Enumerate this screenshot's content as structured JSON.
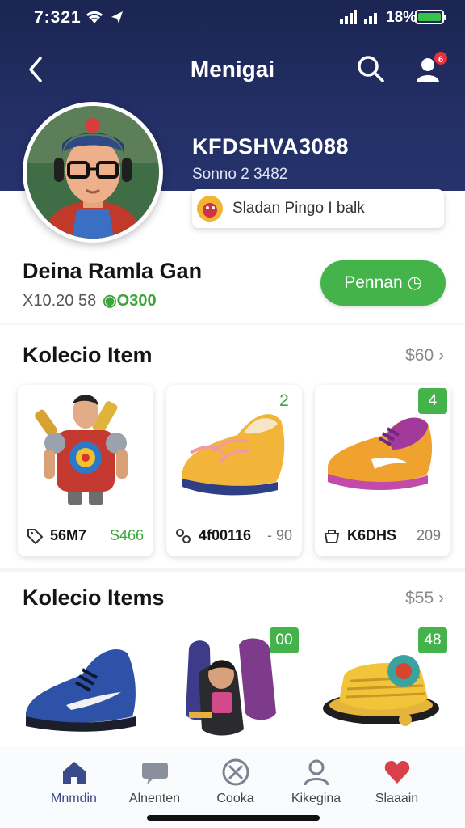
{
  "status_bar": {
    "time": "7:321",
    "battery": "18%"
  },
  "navbar": {
    "title": "Menigai",
    "notification_count": "6"
  },
  "profile": {
    "header_name": "KFDSHVA3088",
    "header_sub": "Sonno 2 3482",
    "page_chip": "Sladan Pingo I balk",
    "name": "Deina Ramla Gan",
    "meta_prefix": "X10.20 58",
    "meta_value": "O300",
    "action_button": "Pennan ◷"
  },
  "section1": {
    "title": "Kolecio Item",
    "more": "$60",
    "items": [
      {
        "name": "56M7",
        "price": "S466",
        "tag": ""
      },
      {
        "name": "4f00116",
        "price": "- 90",
        "tag": "2"
      },
      {
        "name": "K6DHS",
        "price": "209",
        "tag": "4"
      }
    ]
  },
  "section2": {
    "title": "Kolecio Items",
    "more": "$55",
    "items": [
      {
        "tag": ""
      },
      {
        "tag": "00"
      },
      {
        "tag": "48"
      }
    ]
  },
  "tabs": [
    {
      "label": "Mnmdin",
      "icon": "home-icon",
      "active": true
    },
    {
      "label": "Alnenten",
      "icon": "chat-icon",
      "active": false
    },
    {
      "label": "Cooka",
      "icon": "cancel-circle-icon",
      "active": false
    },
    {
      "label": "Kikegina",
      "icon": "profile-icon",
      "active": false
    },
    {
      "label": "Slaaain",
      "icon": "heart-icon",
      "active": false
    }
  ],
  "colors": {
    "header": "#1b2552",
    "accent_green": "#43b34a",
    "badge_red": "#e8313b",
    "active_tab": "#3a4a8a"
  }
}
